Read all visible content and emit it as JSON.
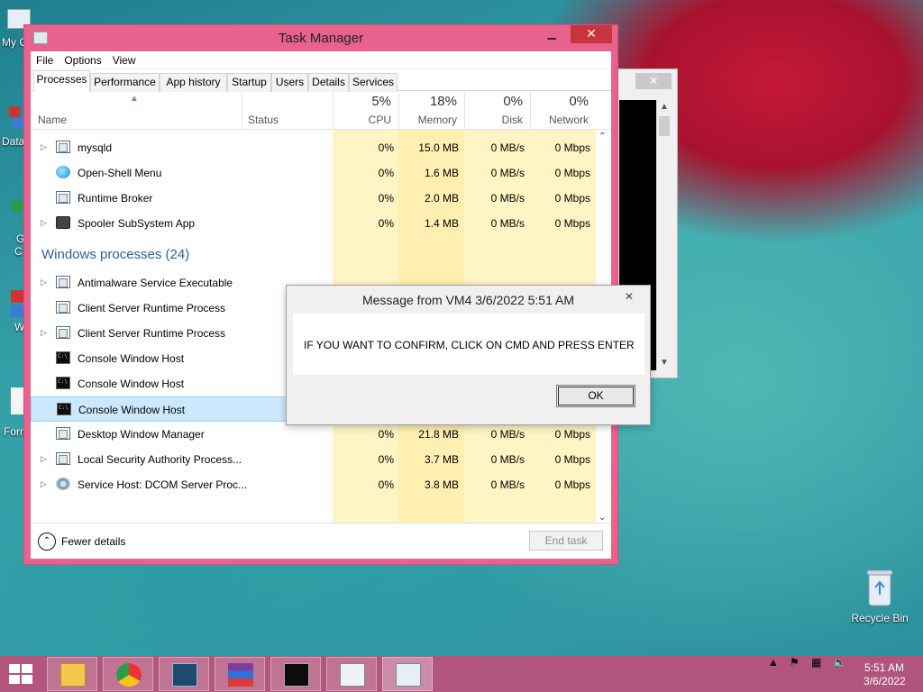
{
  "desktop": {
    "partial_labels": [
      "My C",
      "Data",
      "G",
      "C",
      "W",
      "Form"
    ],
    "recycle_bin_label": "Recycle Bin"
  },
  "task_manager": {
    "title": "Task Manager",
    "menu": [
      "File",
      "Options",
      "View"
    ],
    "tabs": [
      "Processes",
      "Performance",
      "App history",
      "Startup",
      "Users",
      "Details",
      "Services"
    ],
    "active_tab": "Processes",
    "columns": {
      "name": "Name",
      "status": "Status",
      "cpu": {
        "label": "CPU",
        "pct": "5%"
      },
      "memory": {
        "label": "Memory",
        "pct": "18%"
      },
      "disk": {
        "label": "Disk",
        "pct": "0%"
      },
      "network": {
        "label": "Network",
        "pct": "0%"
      }
    },
    "apps_rows": [
      {
        "name": "mysqld",
        "expand": true,
        "icon": "window-icon",
        "cpu": "0%",
        "mem": "15.0 MB",
        "disk": "0 MB/s",
        "net": "0 Mbps"
      },
      {
        "name": "Open-Shell Menu",
        "expand": false,
        "icon": "shell-icon",
        "cpu": "0%",
        "mem": "1.6 MB",
        "disk": "0 MB/s",
        "net": "0 Mbps"
      },
      {
        "name": "Runtime Broker",
        "expand": false,
        "icon": "window-icon",
        "cpu": "0%",
        "mem": "2.0 MB",
        "disk": "0 MB/s",
        "net": "0 Mbps"
      },
      {
        "name": "Spooler SubSystem App",
        "expand": true,
        "icon": "printer-icon",
        "cpu": "0%",
        "mem": "1.4 MB",
        "disk": "0 MB/s",
        "net": "0 Mbps"
      }
    ],
    "windows_group": "Windows processes (24)",
    "windows_rows": [
      {
        "name": "Antimalware Service Executable",
        "expand": true,
        "icon": "window-icon"
      },
      {
        "name": "Client Server Runtime Process",
        "expand": false,
        "icon": "window-icon"
      },
      {
        "name": "Client Server Runtime Process",
        "expand": true,
        "icon": "window-icon"
      },
      {
        "name": "Console Window Host",
        "expand": false,
        "icon": "console-icon"
      },
      {
        "name": "Console Window Host",
        "expand": false,
        "icon": "console-icon"
      },
      {
        "name": "Console Window Host",
        "expand": false,
        "icon": "console-icon",
        "selected": true
      },
      {
        "name": "Desktop Window Manager",
        "expand": false,
        "icon": "window-icon",
        "cpu": "0%",
        "mem": "21.8 MB",
        "disk": "0 MB/s",
        "net": "0 Mbps"
      },
      {
        "name": "Local Security Authority Process...",
        "expand": true,
        "icon": "window-icon",
        "cpu": "0%",
        "mem": "3.7 MB",
        "disk": "0 MB/s",
        "net": "0 Mbps"
      },
      {
        "name": "Service Host: DCOM Server Proc...",
        "expand": true,
        "icon": "gear-icon",
        "cpu": "0%",
        "mem": "3.8 MB",
        "disk": "0 MB/s",
        "net": "0 Mbps"
      }
    ],
    "fewer_details": "Fewer details",
    "end_task": "End task"
  },
  "message_box": {
    "title": "Message from VM4 3/6/2022 5:51 AM",
    "text": "IF YOU WANT TO CONFIRM, CLICK ON CMD AND PRESS ENTER",
    "ok": "OK"
  },
  "taskbar": {
    "time": "5:51 AM",
    "date": "3/6/2022",
    "pinned": [
      "file-explorer-icon",
      "chrome-icon",
      "mysql-workbench-icon",
      "winrar-icon",
      "command-prompt-icon",
      "app-window-icon",
      "task-manager-icon"
    ]
  },
  "colors": {
    "window_frame": "#e8628e",
    "taskbar": "#c44c78",
    "selection": "#cce8ff",
    "group_heading": "#2a5fa0"
  }
}
